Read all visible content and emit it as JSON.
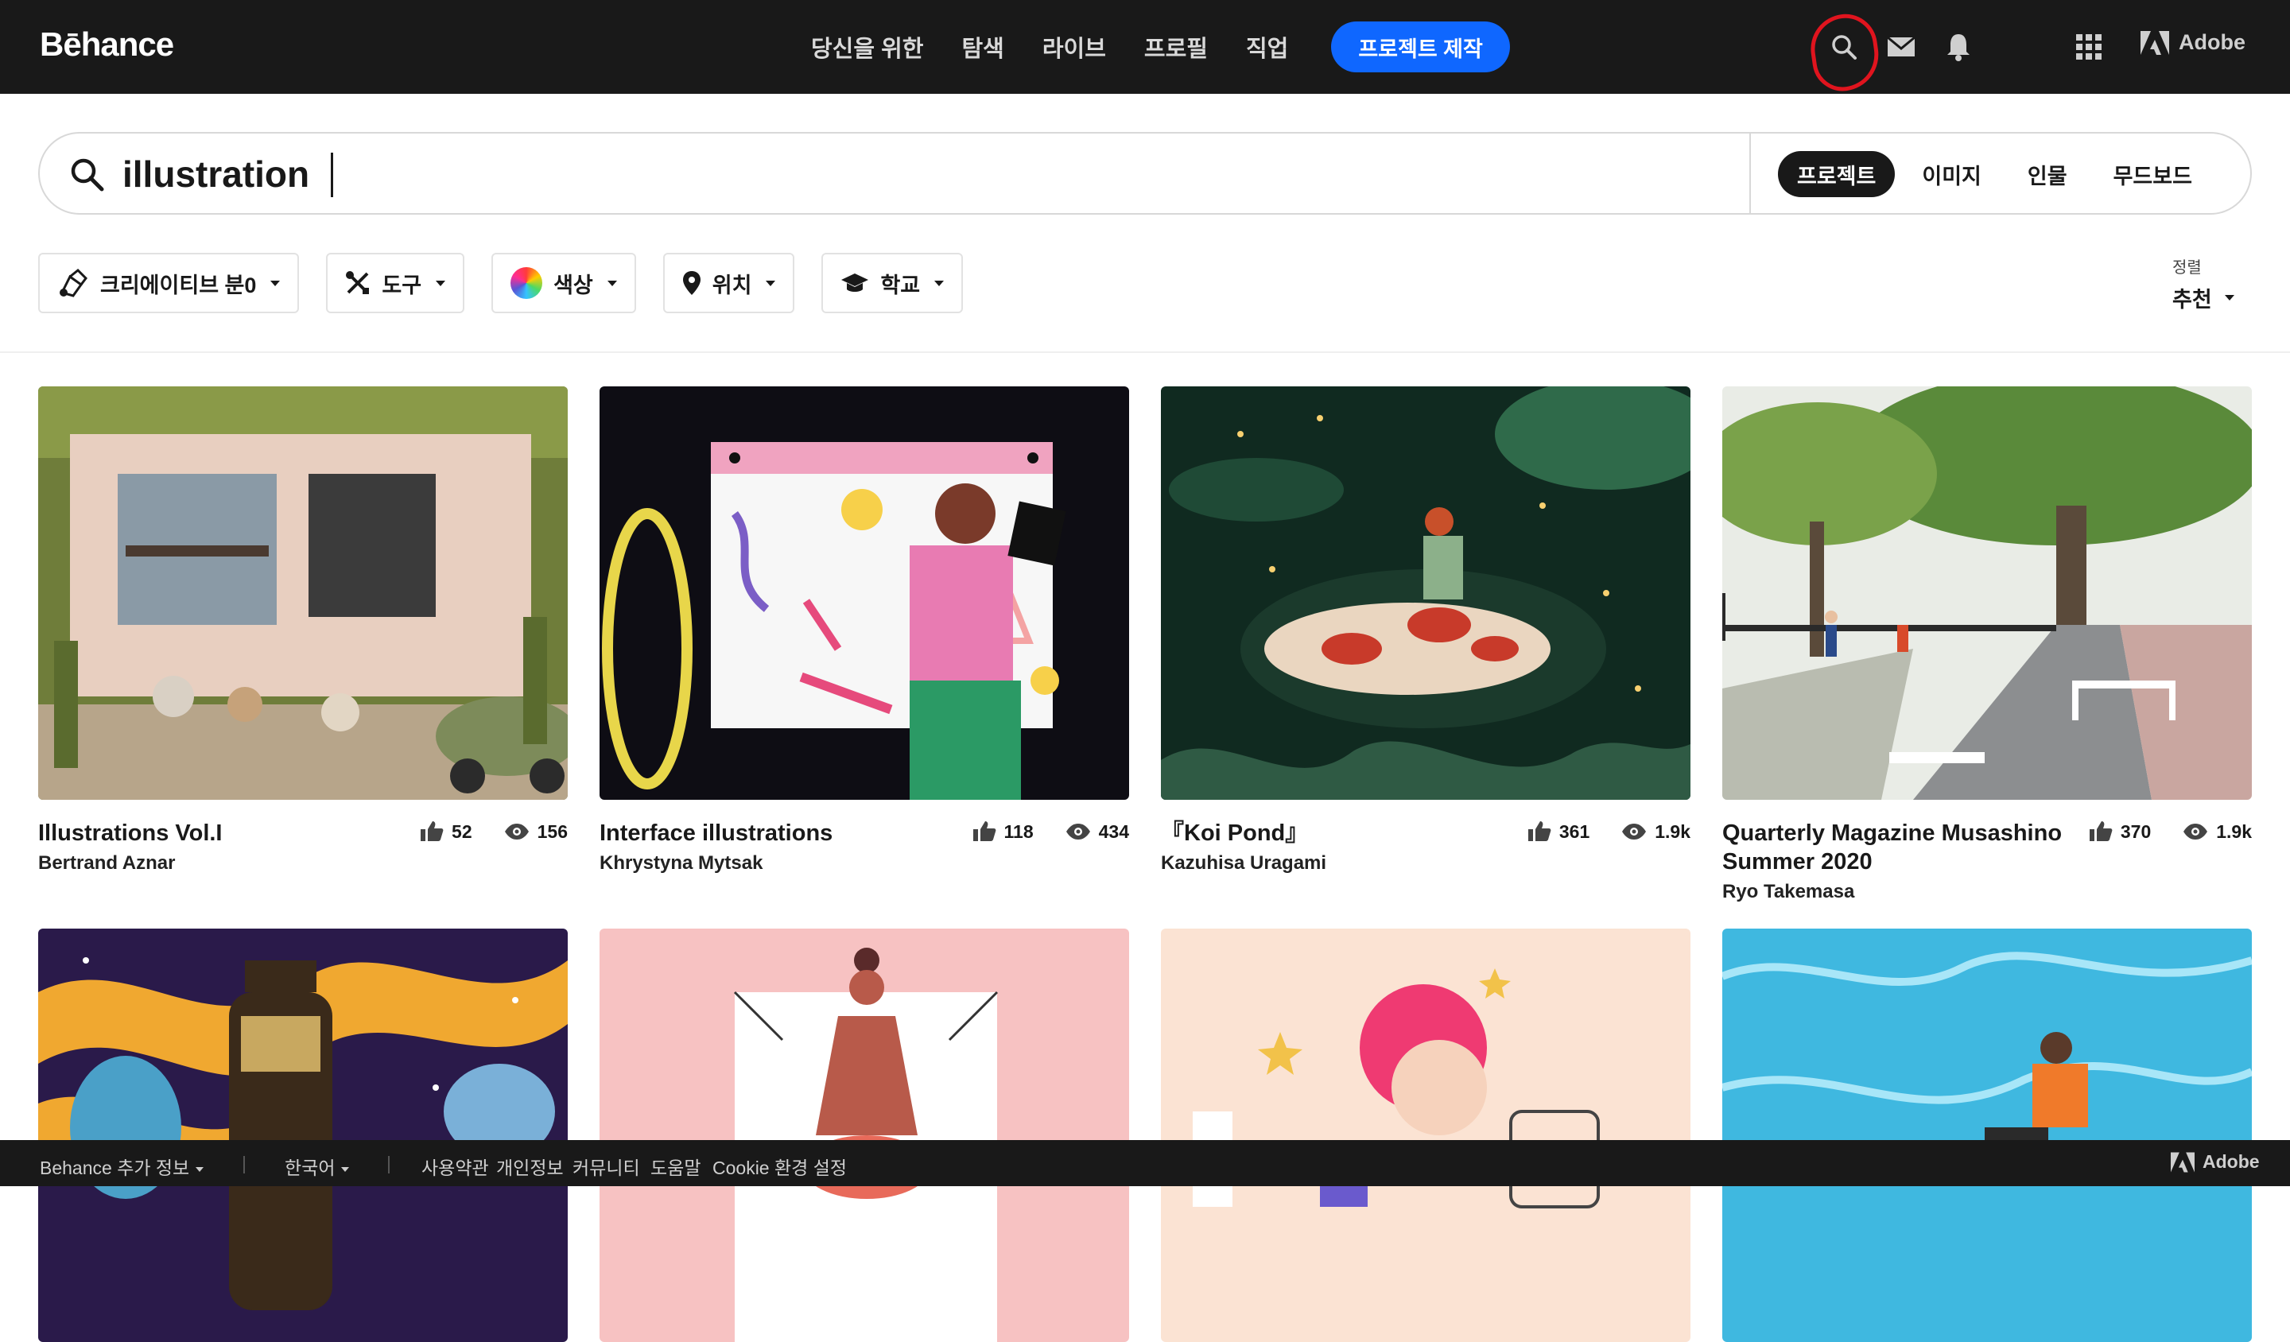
{
  "header": {
    "logo": "Bēhance",
    "nav": [
      "당신을 위한",
      "탐색",
      "라이브",
      "프로필",
      "직업"
    ],
    "create_button": "프로젝트 제작",
    "adobe_label": "Adobe"
  },
  "search": {
    "query": "illustration",
    "tabs": [
      "프로젝트",
      "이미지",
      "인물",
      "무드보드"
    ],
    "active_tab": "프로젝트"
  },
  "filters": {
    "creative_field": "크리에이티브 분0",
    "tools": "도구",
    "color": "색상",
    "location": "위치",
    "school": "학교"
  },
  "sort": {
    "label": "정렬",
    "value": "추천"
  },
  "projects": [
    {
      "title": "Illustrations Vol.I",
      "author": "Bertrand Aznar",
      "likes": "52",
      "views": "156"
    },
    {
      "title": "Interface illustrations",
      "author": "Khrystyna Mytsak",
      "likes": "118",
      "views": "434"
    },
    {
      "title": "『Koi Pond』",
      "author": "Kazuhisa Uragami",
      "likes": "361",
      "views": "1.9k"
    },
    {
      "title": "Quarterly Magazine Musashino Summer 2020",
      "author": "Ryo Takemasa",
      "likes": "370",
      "views": "1.9k"
    }
  ],
  "footer": {
    "more_info": "Behance 추가 정보",
    "language": "한국어",
    "links": [
      "사용약관",
      "개인정보",
      "커뮤니티",
      "도움말",
      "Cookie 환경 설정"
    ],
    "adobe": "Adobe"
  },
  "colors": {
    "accent": "#0f67ff",
    "header_bg": "#191919",
    "annotation": "#e0141e"
  }
}
